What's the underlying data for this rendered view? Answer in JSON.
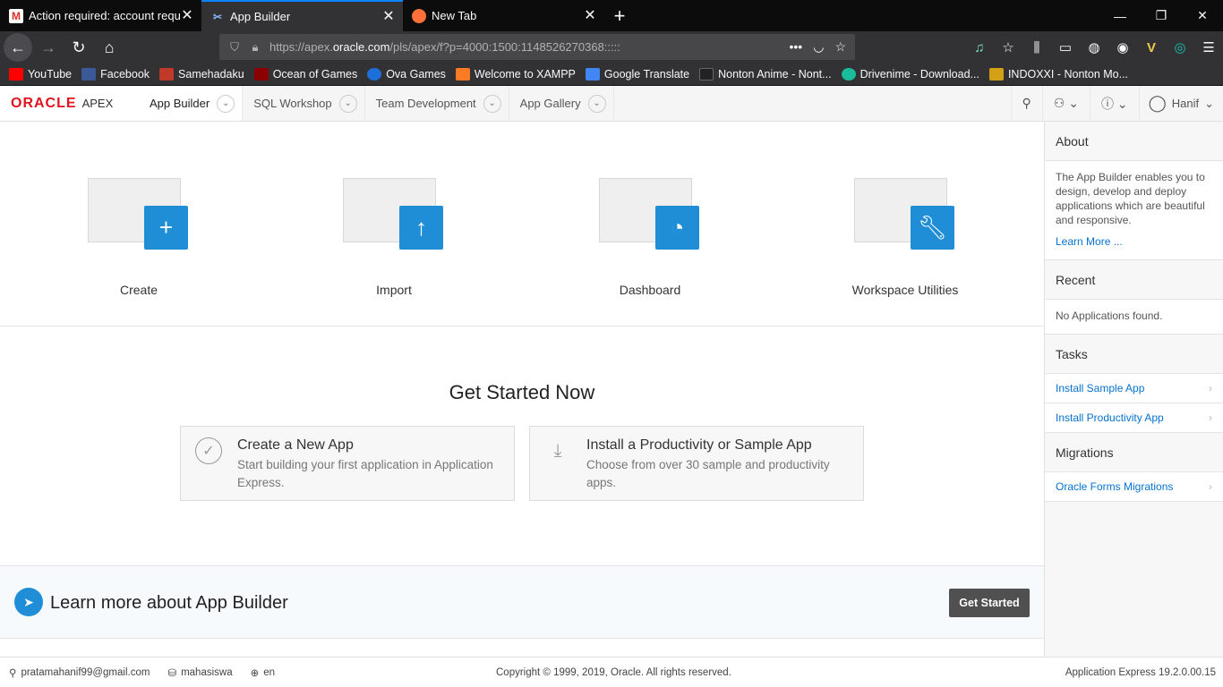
{
  "browser": {
    "tabs": [
      {
        "title": "Action required: account reque",
        "icon": "gmail-icon"
      },
      {
        "title": "App Builder",
        "icon": "apex-icon"
      },
      {
        "title": "New Tab",
        "icon": "firefox-icon"
      }
    ],
    "url_prefix": "https://apex.",
    "url_domain": "oracle.com",
    "url_suffix": "/pls/apex/f?p=4000:1500:1148526270368:::::",
    "bookmarks": [
      "YouTube",
      "Facebook",
      "Samehadaku",
      "Ocean of Games",
      "Ova Games",
      "Welcome to XAMPP",
      "Google Translate",
      "Nonton Anime - Nont...",
      "Drivenime - Download...",
      "INDOXXI - Nonton Mo..."
    ]
  },
  "header": {
    "logo_oracle": "ORACLE",
    "logo_apex": "APEX",
    "tabs": [
      "App Builder",
      "SQL Workshop",
      "Team Development",
      "App Gallery"
    ],
    "user": "Hanif"
  },
  "tiles": [
    "Create",
    "Import",
    "Dashboard",
    "Workspace Utilities"
  ],
  "get_started": {
    "title": "Get Started Now",
    "cards": [
      {
        "title": "Create a New App",
        "desc": "Start building your first application in Application Express."
      },
      {
        "title": "Install a Productivity or Sample App",
        "desc": "Choose from over 30 sample and productivity apps."
      }
    ]
  },
  "learn": {
    "text": "Learn more about App Builder",
    "button": "Get Started"
  },
  "sidebar": {
    "about_title": "About",
    "about_text": "The App Builder enables you to design, develop and deploy applications which are beautiful and responsive.",
    "learn_more": "Learn More ...",
    "recent_title": "Recent",
    "recent_empty": "No Applications found.",
    "tasks_title": "Tasks",
    "tasks": [
      "Install Sample App",
      "Install Productivity App"
    ],
    "migrations_title": "Migrations",
    "migrations": [
      "Oracle Forms Migrations"
    ]
  },
  "footer": {
    "email": "pratamahanif99@gmail.com",
    "workspace": "mahasiswa",
    "language": "en",
    "copyright": "Copyright © 1999, 2019, Oracle. All rights reserved.",
    "version": "Application Express 19.2.0.00.15"
  },
  "colors": {
    "accent": "#1f8ed6",
    "oracle_red": "#e0141e",
    "link": "#0572ce"
  }
}
